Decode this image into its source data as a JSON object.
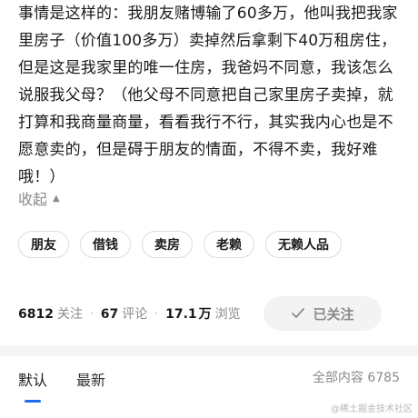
{
  "question": {
    "body": "事情是这样的：我朋友赌博输了60多万，他叫我把我家里房子（价值100多万）卖掉然后拿剩下40万租房住，但是这是我家里的唯一住房，我爸妈不同意，我该怎么说服我父母？（他父母不同意把自己家里房子卖掉，就打算和我商量商量，看看我行不行，其实我内心也是不愿意卖的，但是碍于朋友的情面，不得不卖，我好难哦！）"
  },
  "collapse": {
    "label": "收起",
    "icon": "caret-up-icon"
  },
  "tags": [
    {
      "label": "朋友"
    },
    {
      "label": "借钱"
    },
    {
      "label": "卖房"
    },
    {
      "label": "老赖"
    },
    {
      "label": "无赖人品"
    }
  ],
  "stats": {
    "followers": {
      "value": "6812",
      "label": "关注"
    },
    "comments": {
      "value": "67",
      "label": "评论"
    },
    "views": {
      "value": "17.1",
      "unit": "万",
      "label": "浏览"
    }
  },
  "follow_button": {
    "label": "已关注",
    "icon": "check-icon"
  },
  "tabs": [
    {
      "label": "默认",
      "active": true
    },
    {
      "label": "最新",
      "active": false
    }
  ],
  "all_content": {
    "label": "全部内容",
    "count": "6785"
  },
  "watermark": "@稀土掘金技术社区",
  "colors": {
    "accent": "#1a6cf0",
    "muted": "#8a8a8a",
    "button_bg": "#f3f3f3"
  }
}
